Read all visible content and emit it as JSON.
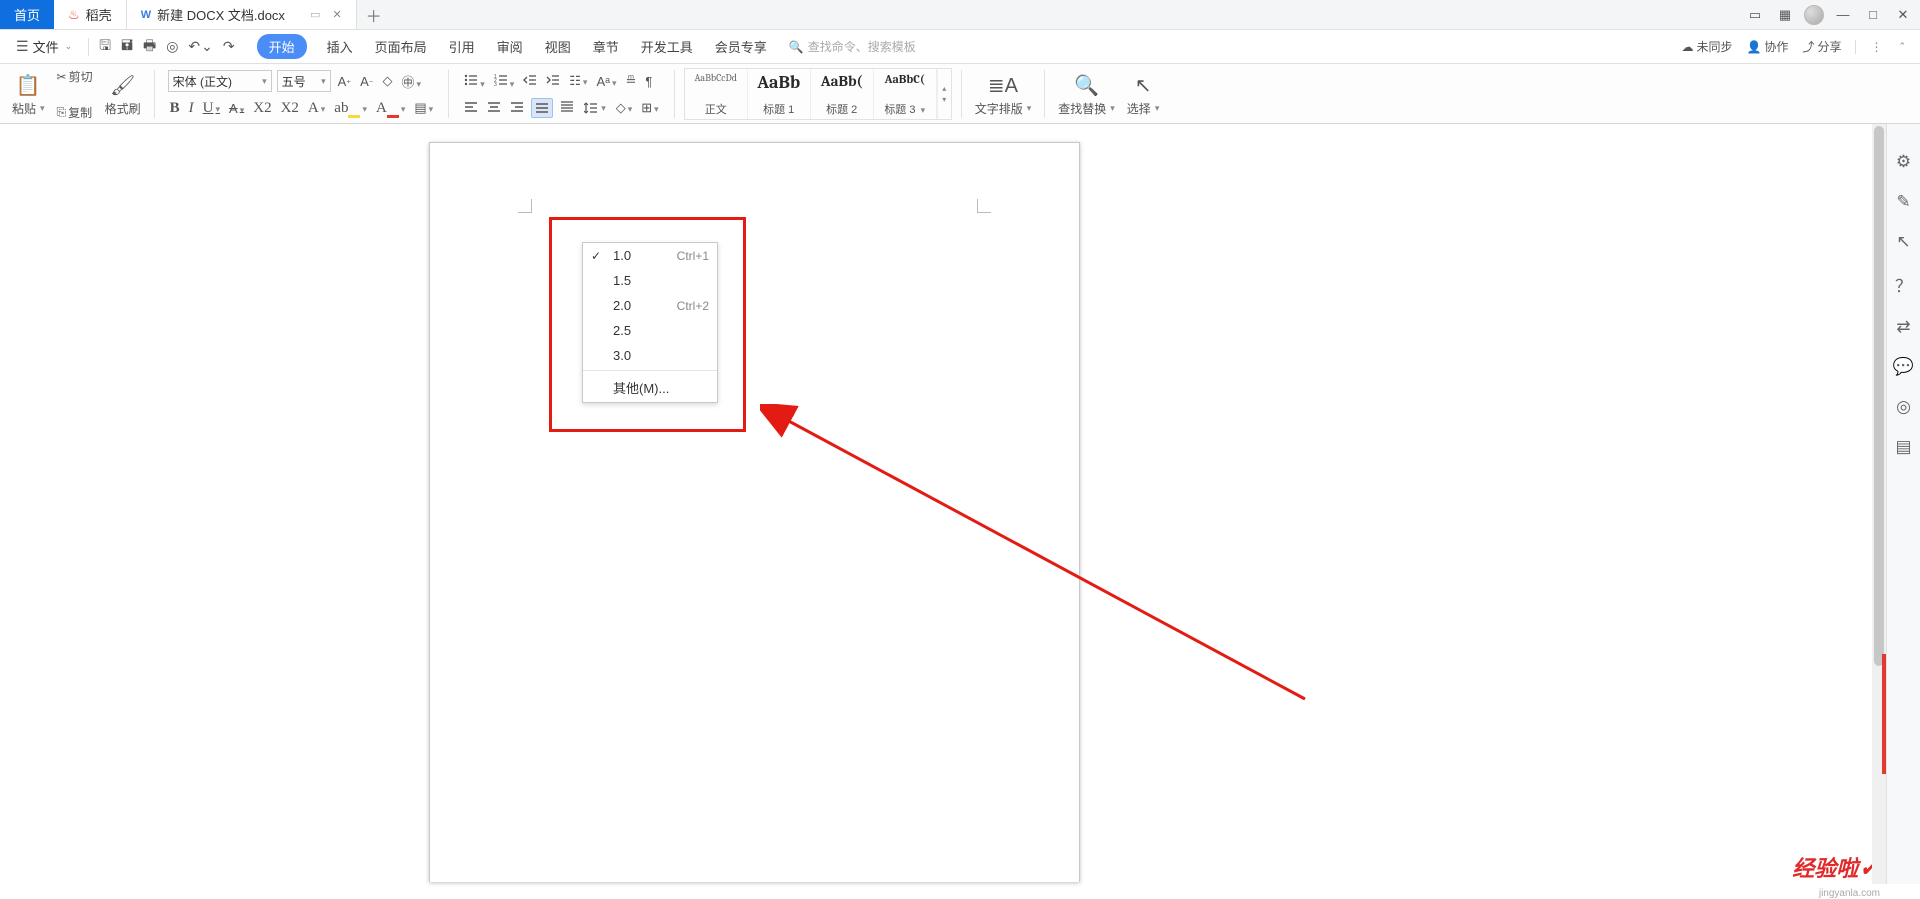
{
  "tabs_bar": {
    "home_label": "首页",
    "shell_label": "稻壳",
    "doc_label": "新建 DOCX 文档.docx"
  },
  "menu": {
    "file": "文件",
    "items": [
      "开始",
      "插入",
      "页面布局",
      "引用",
      "审阅",
      "视图",
      "章节",
      "开发工具",
      "会员专享"
    ],
    "search_placeholder": "查找命令、搜索模板",
    "right": {
      "not_synced": "未同步",
      "collab": "协作",
      "share": "分享"
    }
  },
  "ribbon": {
    "paste": "粘贴",
    "cut": "剪切",
    "copy": "复制",
    "format_brush": "格式刷",
    "font_name": "宋体 (正文)",
    "font_size": "五号",
    "text_typeset": "文字排版",
    "find_replace": "查找替换",
    "select": "选择",
    "styles": {
      "normal": "正文",
      "h1": "标题 1",
      "h2": "标题 2",
      "h3": "标题 3",
      "prev_normal": "AaBbCcDd",
      "prev_h1": "AaBb",
      "prev_h2": "AaBb(",
      "prev_h3": "AaBbC("
    }
  },
  "line_spacing": {
    "items": [
      {
        "label": "1.0",
        "shortcut": "Ctrl+1",
        "checked": true
      },
      {
        "label": "1.5",
        "shortcut": "",
        "checked": false
      },
      {
        "label": "2.0",
        "shortcut": "Ctrl+2",
        "checked": false
      },
      {
        "label": "2.5",
        "shortcut": "",
        "checked": false
      },
      {
        "label": "3.0",
        "shortcut": "",
        "checked": false
      }
    ],
    "more": "其他(M)..."
  },
  "watermark": {
    "text": "经验啦",
    "sub": "jingyanla.com"
  }
}
